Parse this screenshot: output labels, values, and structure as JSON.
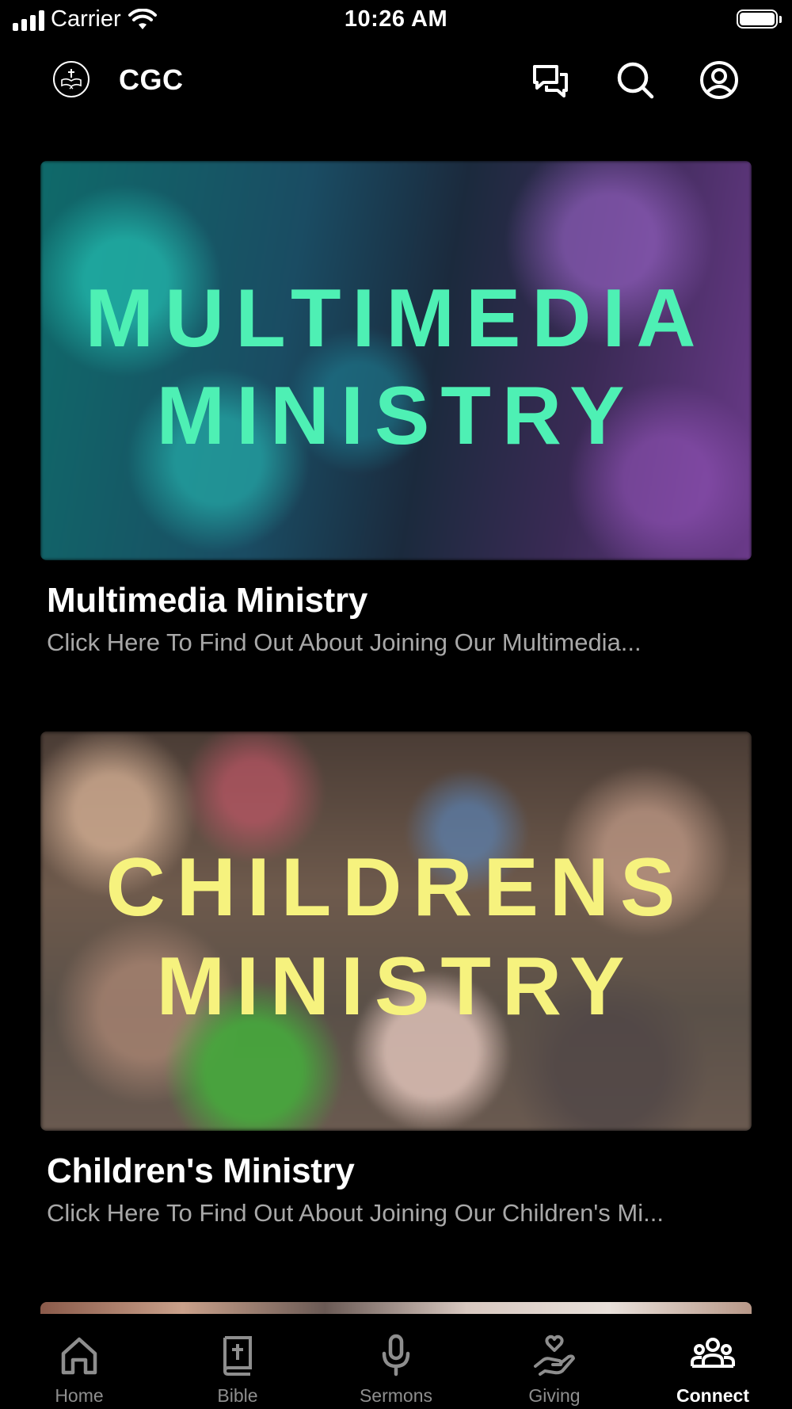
{
  "status_bar": {
    "carrier": "Carrier",
    "time": "10:26 AM"
  },
  "header": {
    "title": "CGC",
    "icons": [
      "chat-icon",
      "search-icon",
      "profile-icon"
    ]
  },
  "cards": [
    {
      "image_text": [
        "MULTIMEDIA",
        "MINISTRY"
      ],
      "image_text_color": "#4ef0b4",
      "title": "Multimedia Ministry",
      "subtitle": "Click Here To Find Out About Joining Our Multimedia..."
    },
    {
      "image_text": [
        "CHILDRENS",
        "MINISTRY"
      ],
      "image_text_color": "#f6f27e",
      "title": "Children's Ministry",
      "subtitle": "Click Here To Find Out About Joining Our Children's Mi..."
    }
  ],
  "tabs": [
    {
      "label": "Home",
      "icon": "home-icon",
      "active": false
    },
    {
      "label": "Bible",
      "icon": "bible-icon",
      "active": false
    },
    {
      "label": "Sermons",
      "icon": "microphone-icon",
      "active": false
    },
    {
      "label": "Giving",
      "icon": "giving-hand-icon",
      "active": false
    },
    {
      "label": "Connect",
      "icon": "people-icon",
      "active": true
    }
  ]
}
